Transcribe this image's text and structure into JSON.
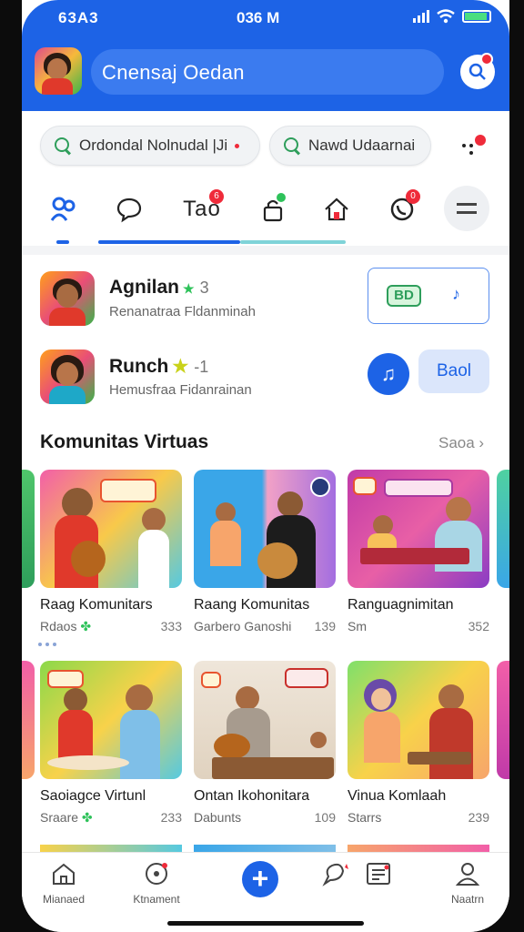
{
  "status": {
    "time": "63A3",
    "center": "036 M"
  },
  "header": {
    "search_text": "Cnensaj Oedan"
  },
  "chips": [
    {
      "label": "Ordondal Nolnudal |Ji"
    },
    {
      "label": "Nawd Udaarnai"
    }
  ],
  "tabs": [
    {
      "name": "tab-home",
      "text": ""
    },
    {
      "name": "tab-chat",
      "text": ""
    },
    {
      "name": "tab-text",
      "text": "Tao",
      "badge": "6"
    },
    {
      "name": "tab-lock",
      "text": ""
    },
    {
      "name": "tab-house",
      "text": ""
    },
    {
      "name": "tab-call",
      "text": "",
      "badge": "0"
    }
  ],
  "users": [
    {
      "name": "Agnilan",
      "num": "3",
      "sub": "Renanatraa Fldanminah",
      "action": "BD"
    },
    {
      "name": "Runch",
      "num": "-1",
      "sub": "Hemusfraa Fidanrainan",
      "action": "Baol"
    }
  ],
  "section": {
    "title": "Komunitas Virtuas",
    "more": "Saoa"
  },
  "cards": [
    {
      "title": "Raag Komunitars",
      "sub": "Rdaos",
      "num": "333"
    },
    {
      "title": "Raang Komunitas",
      "sub": "Garbero Ganoshi",
      "num": "139"
    },
    {
      "title": "Ranguagnimitan",
      "sub": "Sm",
      "num": "352"
    },
    {
      "title": "Saoiagce Virtunl",
      "sub": "Sraare",
      "num": "233"
    },
    {
      "title": "Ontan Ikohonitara",
      "sub": "Dabunts",
      "num": "109"
    },
    {
      "title": "Vinua Komlaah",
      "sub": "Starrs",
      "num": "239"
    }
  ],
  "nav": [
    {
      "label": "Mianaed"
    },
    {
      "label": "Ktnament"
    },
    {
      "label": ""
    },
    {
      "label": ""
    },
    {
      "label": "Naatrn"
    }
  ],
  "colors": {
    "brand": "#1d63e6",
    "badge": "#ef2b3a",
    "accent_green": "#2e9e5b"
  }
}
